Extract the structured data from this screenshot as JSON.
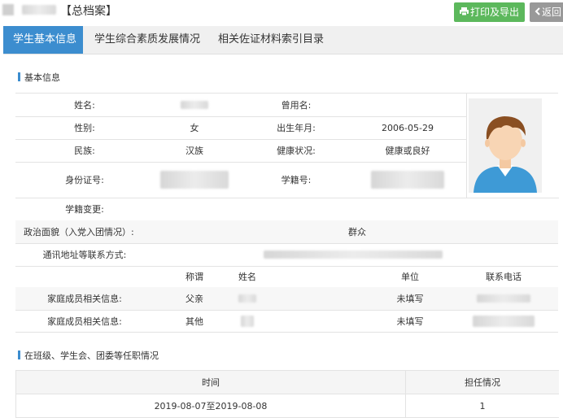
{
  "header": {
    "title": "【总档案】",
    "print_button": "打印及导出",
    "back_button": "返回"
  },
  "tabs": [
    {
      "label": "学生基本信息",
      "active": true
    },
    {
      "label": "学生综合素质发展情况",
      "active": false
    },
    {
      "label": "相关佐证材料索引目录",
      "active": false
    }
  ],
  "basic_info": {
    "section_title": "基本信息",
    "name_label": "姓名:",
    "former_name_label": "曾用名:",
    "gender_label": "性别:",
    "gender_value": "女",
    "birth_label": "出生年月:",
    "birth_value": "2006-05-29",
    "ethnicity_label": "民族:",
    "ethnicity_value": "汉族",
    "health_label": "健康状况:",
    "health_value": "健康或良好",
    "id_label": "身份证号:",
    "student_no_label": "学籍号:",
    "status_change_label": "学籍变更:",
    "political_label": "政治面貌（入党入团情况）:",
    "political_value": "群众",
    "address_label": "通讯地址等联系方式:",
    "family_headers": [
      "称谓",
      "姓名",
      "单位",
      "联系电话"
    ],
    "family_members": [
      {
        "label": "家庭成员相关信息:",
        "relation": "父亲",
        "unit": "未填写"
      },
      {
        "label": "家庭成员相关信息:",
        "relation": "其他",
        "unit": "未填写"
      }
    ]
  },
  "positions": {
    "section_title": "在班级、学生会、团委等任职情况",
    "headers": [
      "时间",
      "担任情况"
    ],
    "rows": [
      {
        "time": "2019-08-07至2019-08-08",
        "role": "1"
      }
    ]
  },
  "colors": {
    "accent": "#3c8dcf",
    "print_button": "#5cb85c",
    "back_button": "#999999"
  },
  "icons": {
    "print": "print-icon",
    "back": "chevron-left-icon",
    "photo": "student-avatar-placeholder"
  }
}
